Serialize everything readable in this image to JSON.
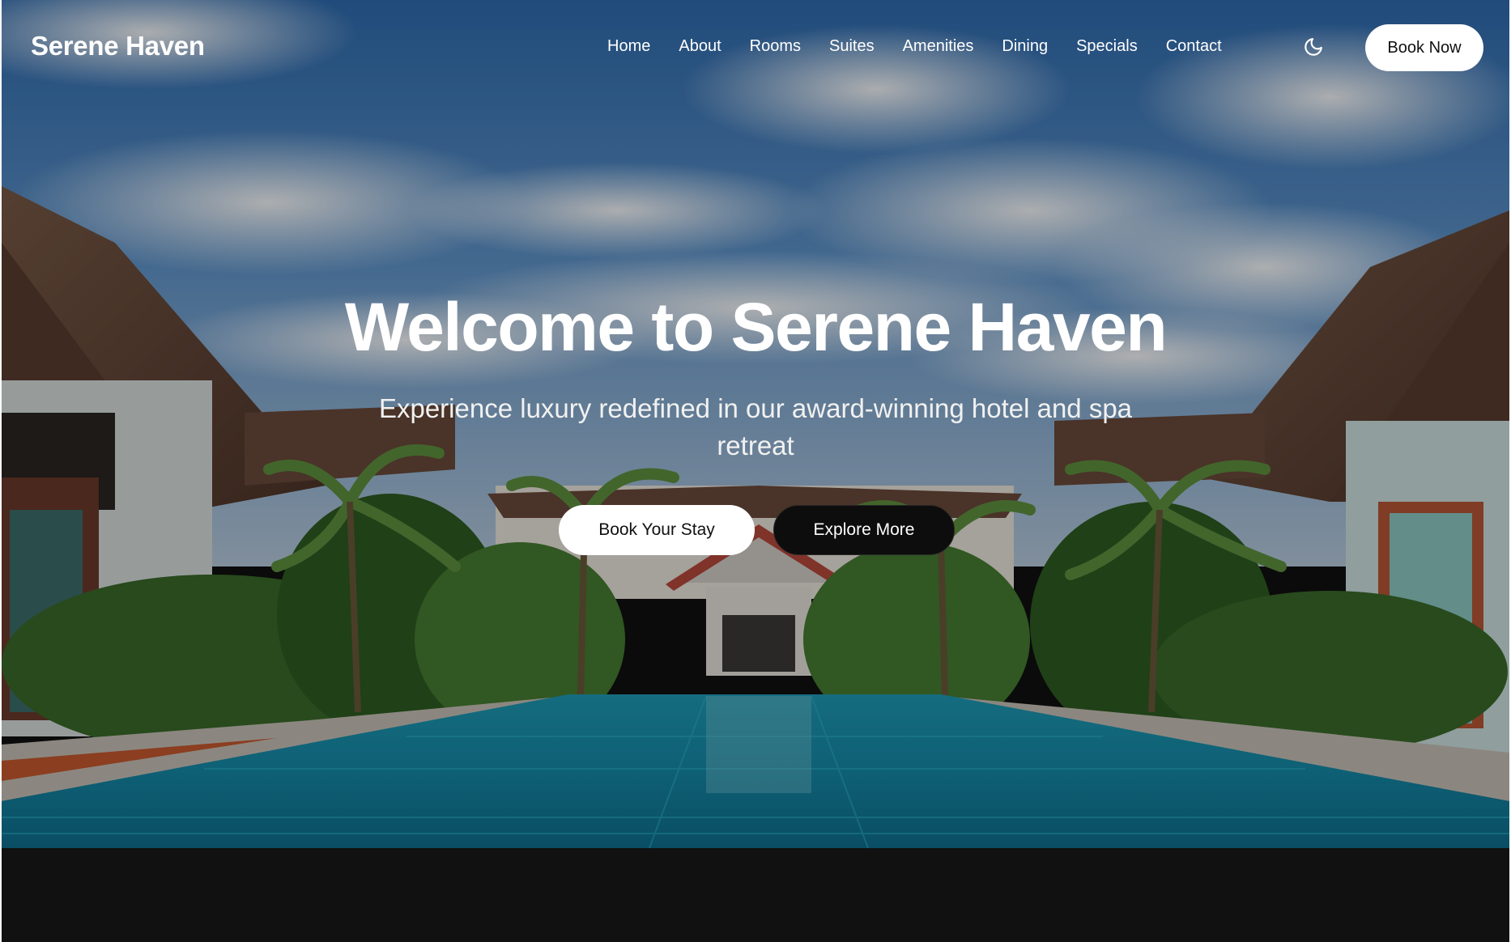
{
  "brand": {
    "name": "Serene Haven"
  },
  "nav": {
    "links": [
      "Home",
      "About",
      "Rooms",
      "Suites",
      "Amenities",
      "Dining",
      "Specials",
      "Contact"
    ],
    "theme_icon": "moon-icon",
    "book_now_label": "Book Now"
  },
  "hero": {
    "title": "Welcome to Serene Haven",
    "subtitle": "Experience luxury redefined in our award-winning hotel and spa retreat",
    "primary_cta": "Book Your Stay",
    "secondary_cta": "Explore More",
    "background": "resort-pool-photo"
  },
  "colors": {
    "primary_button_bg": "#ffffff",
    "secondary_button_bg": "#0d0d0d",
    "page_background": "#111111",
    "text_on_hero": "#ffffff"
  }
}
